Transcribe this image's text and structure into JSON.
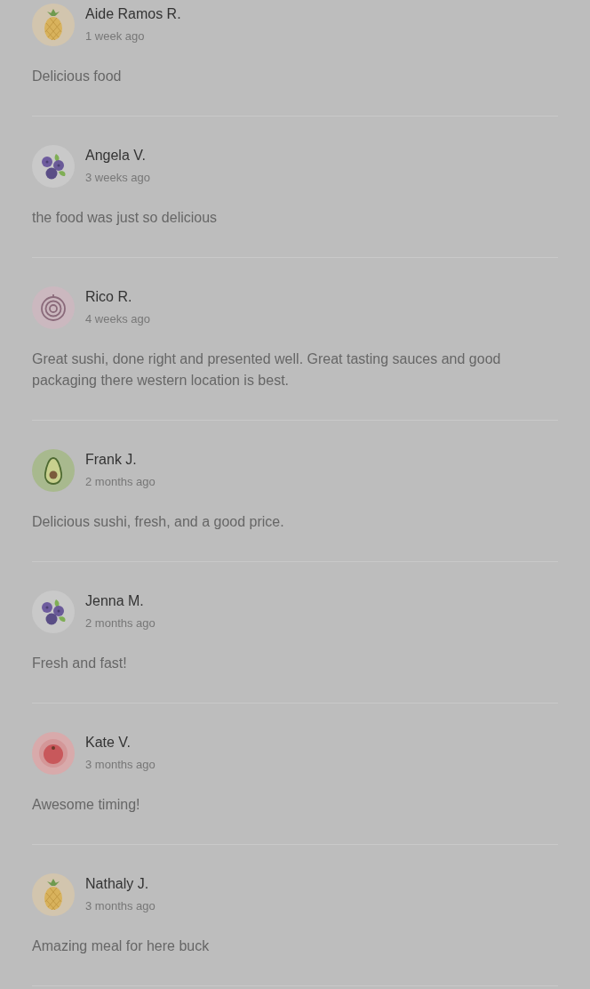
{
  "reviews": [
    {
      "name": "Aide Ramos R.",
      "time": "1 week ago",
      "comment": "Delicious food",
      "avatar": {
        "kind": "pineapple"
      }
    },
    {
      "name": "Angela V.",
      "time": "3 weeks ago",
      "comment": "the food was just so delicious",
      "avatar": {
        "kind": "blueberries"
      }
    },
    {
      "name": "Rico R.",
      "time": "4 weeks ago",
      "comment": "Great sushi, done right and presented well. Great tasting sauces and good packaging there western location is best.",
      "avatar": {
        "kind": "onion"
      }
    },
    {
      "name": "Frank J.",
      "time": "2 months ago",
      "comment": "Delicious sushi, fresh, and a good price.",
      "avatar": {
        "kind": "avocado"
      }
    },
    {
      "name": "Jenna M.",
      "time": "2 months ago",
      "comment": "Fresh and fast!",
      "avatar": {
        "kind": "blueberries"
      }
    },
    {
      "name": "Kate V.",
      "time": "3 months ago",
      "comment": "Awesome timing!",
      "avatar": {
        "kind": "tomato"
      }
    },
    {
      "name": "Nathaly J.",
      "time": "3 months ago",
      "comment": "Amazing meal for here buck",
      "avatar": {
        "kind": "pineapple"
      }
    }
  ]
}
